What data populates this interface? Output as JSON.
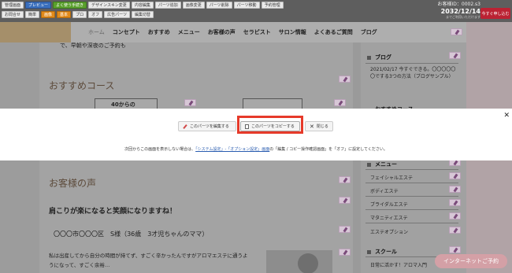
{
  "adminbar": {
    "row1": [
      "管理画面",
      "プレビュー",
      "よく使う手続き",
      "デザインスキン変更",
      "内容編集",
      "パーツ追加",
      "画像変更",
      "パーツ削除",
      "パーツ移動",
      "予約管理"
    ],
    "row2": [
      "お問合せ",
      "簡単",
      "画像",
      "基本",
      "プロ",
      "オフ",
      "広告パーツ",
      "編集切替"
    ],
    "customer_id": "お客様ID：0002.s3",
    "date": "2032/12/14",
    "date_sub": "までご利用いただけます",
    "red_button": "今すぐ申し込む"
  },
  "nav": {
    "items": [
      "ホーム",
      "コンセプト",
      "おすすめ",
      "メニュー",
      "お客様の声",
      "セラピスト",
      "サロン情報",
      "よくあるご質問",
      "ブログ"
    ]
  },
  "main": {
    "intro": "で、早朝や深夜のご予約も",
    "recommend_heading": "おすすめコース",
    "card_text": "40からの",
    "voice_heading": "お客様の声",
    "voice_subtitle": "肩こりが楽になると笑顔になりますね！",
    "voice_name": "〇〇〇市〇〇〇区　S様（36歳　3才児ちゃんのママ）",
    "voice_body_1": "私は出産してから自分の時間が持てず、すごく辛かったんですがアロマエステに通うよ",
    "voice_body_2": "うになって、すごく余裕…"
  },
  "sidebar": {
    "blog_title": "ブログ",
    "blog_item": "2021/02/17 今すぐできる。〇〇〇〇〇〇でする3つの方法（ブログサンプル）",
    "recommend_title": "おすすめコース",
    "menu_title": "メニュー",
    "menu_items": [
      "フェイシャルエステ",
      "ボディエステ",
      "ブライダルエステ",
      "マタニティエステ",
      "エステオプション"
    ],
    "school_title": "スクール",
    "school_item": "日常に活かす！アロマ入門"
  },
  "cta": "インターネットご予約",
  "modal": {
    "edit_button": "このパーツを編集する",
    "copy_button": "このパーツをコピーする",
    "close_button": "閉じる",
    "note_before": "次回からこの画面を表示しない場合は、",
    "note_link": "「システム設定」-「オプション設定」画面",
    "note_after": "の「編集 / コピー操作確認画面」を「オフ」に設定してください。"
  }
}
